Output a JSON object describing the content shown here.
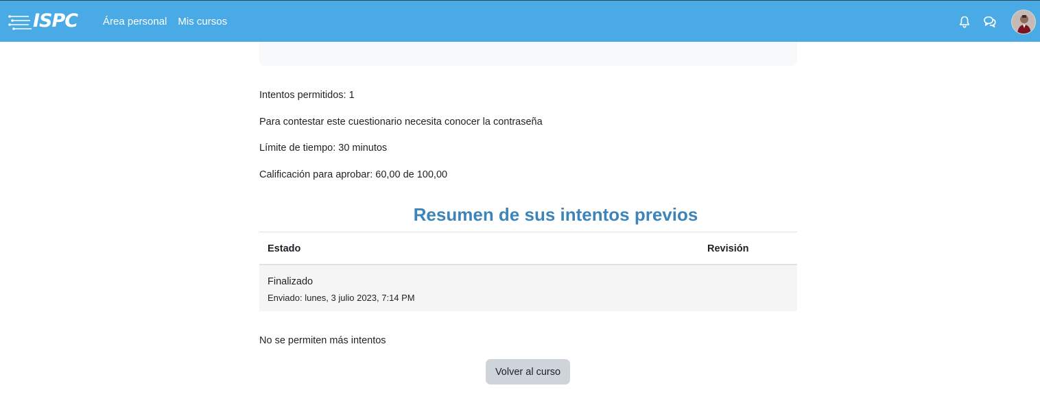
{
  "navbar": {
    "logo_text": "ISPC",
    "links": [
      "Área personal",
      "Mis cursos"
    ],
    "icons": [
      "bell-icon",
      "chat-icon"
    ],
    "background": "#49aae6"
  },
  "quiz_info": {
    "attempts": "Intentos permitidos: 1",
    "password": "Para contestar este cuestionario necesita conocer la contraseña",
    "time_limit": "Límite de tiempo: 30 minutos",
    "pass_grade": "Calificación para aprobar: 60,00 de 100,00"
  },
  "summary": {
    "title": "Resumen de sus intentos previos",
    "headers": {
      "state": "Estado",
      "review": "Revisión"
    },
    "rows": [
      {
        "state": "Finalizado",
        "sent": "Enviado: lunes, 3 julio 2023, 7:14 PM"
      }
    ]
  },
  "no_more_attempts": "No se permiten más intentos",
  "back_button": "Volver al curso",
  "colors": {
    "accent": "#3d85b9",
    "button": "#ced4da"
  }
}
